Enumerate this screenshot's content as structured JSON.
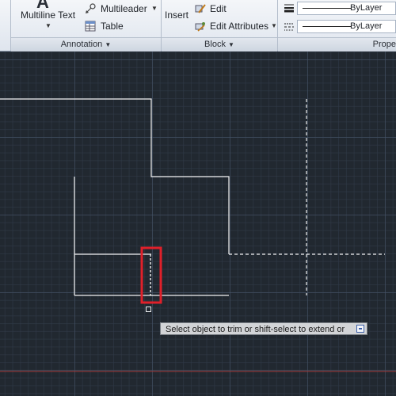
{
  "ribbon": {
    "annotation": {
      "multiline_text_label": "Multiline Text",
      "multileader_label": "Multileader",
      "table_label": "Table",
      "panel_title": "Annotation"
    },
    "block": {
      "insert_label": "Insert",
      "edit_label": "Edit",
      "edit_attributes_label": "Edit Attributes",
      "panel_title": "Block"
    },
    "properties": {
      "linetype_value": "ByLayer",
      "lineweight_value": "ByLayer",
      "panel_title": "Prope"
    }
  },
  "canvas": {
    "tooltip_text": "Select object to trim or shift-select to extend or",
    "selection_highlight_color": "#e0202a",
    "drawing_line_color": "#f2f2f2",
    "axis_color": "#b03030"
  },
  "icons": [
    "text-a-icon",
    "multileader-icon",
    "table-icon",
    "edit-block-icon",
    "edit-attributes-icon",
    "linetype-icon",
    "lineweight-icon",
    "tooltip-expand-icon"
  ]
}
